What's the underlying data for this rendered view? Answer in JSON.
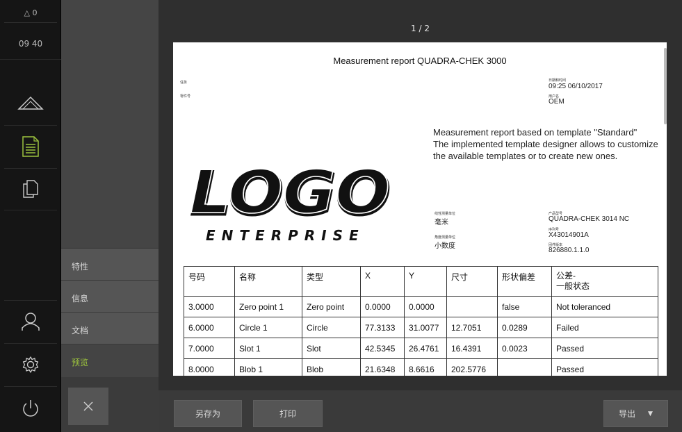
{
  "status": {
    "warnings": "0",
    "time": "09 40"
  },
  "iconbar": {
    "icons": [
      "measure-icon",
      "report-icon",
      "file-manager-icon",
      "user-icon",
      "settings-icon",
      "power-icon"
    ]
  },
  "submenu": {
    "items": [
      {
        "label": "特性"
      },
      {
        "label": "信息"
      },
      {
        "label": "文档"
      },
      {
        "label": "预览"
      }
    ],
    "active_color": "#9dc43e"
  },
  "preview": {
    "page_indicator": "1 / 2",
    "report_title": "Measurement report QUADRA-CHEK 3000",
    "left_meta": {
      "task_label": "任务",
      "part_no_label": "零件号"
    },
    "date_label": "日期和时间",
    "date_value": "09:25 06/10/2017",
    "user_label": "用户名",
    "user_value": "OEM",
    "description": [
      "Measurement report based on template \"Standard\"",
      "The implemented template designer allows to customize",
      "the available templates or to create new ones."
    ],
    "logo": {
      "main": "LOGO",
      "sub": "ENTERPRISE"
    },
    "linear_unit_label": "线性测量单位",
    "linear_unit_value": "毫米",
    "angle_unit_label": "角度测量单位",
    "angle_unit_value": "小数度",
    "product_label": "产品型号",
    "product_value": "QUADRA-CHEK 3014 NC",
    "serial_label": "序列号",
    "serial_value": "X43014901A",
    "firmware_label": "固件版本",
    "firmware_value": "826880.1.1.0",
    "table": {
      "headers": [
        "号码",
        "名称",
        "类型",
        "X",
        "Y",
        "尺寸",
        "形状偏差",
        "公差-\n一般状态"
      ],
      "rows": [
        [
          "3.0000",
          "Zero point 1",
          "Zero point",
          "0.0000",
          "0.0000",
          "",
          "false",
          "Not toleranced"
        ],
        [
          "6.0000",
          "Circle 1",
          "Circle",
          "77.3133",
          "31.0077",
          "12.7051",
          "0.0289",
          "Failed"
        ],
        [
          "7.0000",
          "Slot 1",
          "Slot",
          "42.5345",
          "26.4761",
          "16.4391",
          "0.0023",
          "Passed"
        ],
        [
          "8.0000",
          "Blob 1",
          "Blob",
          "21.6348",
          "8.6616",
          "202.5776",
          "",
          "Passed"
        ]
      ]
    }
  },
  "footer": {
    "save_as": "另存为",
    "print": "打印",
    "export": "导出",
    "export_caret": "▼"
  }
}
